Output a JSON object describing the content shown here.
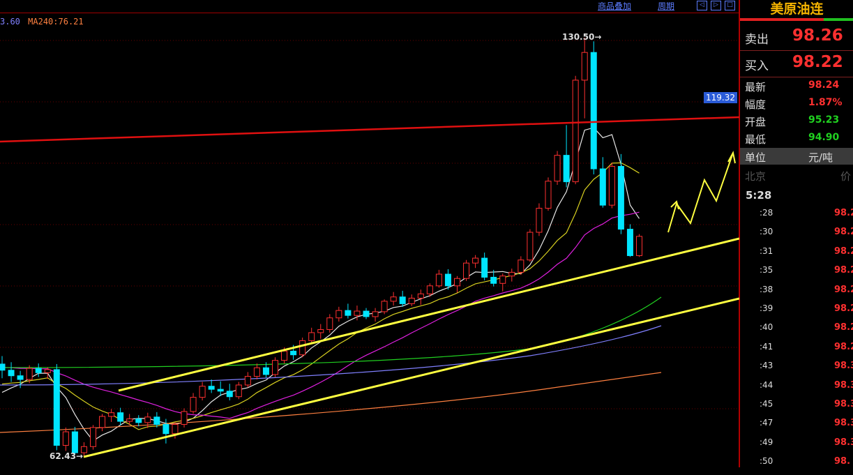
{
  "toolbar": {
    "ma_text": "3.60",
    "ma240_text": "MA240:76.21",
    "overlay_link": "商品叠加",
    "period_link": "周期",
    "nav_left": "◁",
    "nav_right": "▷",
    "nav_box": "□"
  },
  "chart_labels": {
    "high": "130.50",
    "low": "62.43",
    "current_price_tag": "119.32"
  },
  "quote_panel": {
    "title": "美原油连",
    "sell_label": "卖出",
    "sell_value": "98.26",
    "buy_label": "买入",
    "buy_value": "98.22",
    "stats": [
      {
        "label": "最新",
        "value": "98.24",
        "color": "#ff3030"
      },
      {
        "label": "幅度",
        "value": "1.87%",
        "color": "#ff3030"
      },
      {
        "label": "开盘",
        "value": "95.23",
        "color": "#20d020"
      },
      {
        "label": "最低",
        "value": "94.90",
        "color": "#20d020"
      }
    ],
    "unit_label": "单位",
    "unit_value": "元/吨",
    "tick_header_left": "北京",
    "tick_header_right": "价",
    "first_time": "5:28",
    "ticks": [
      {
        "time": ":28",
        "price": "98.2"
      },
      {
        "time": ":30",
        "price": "98.2"
      },
      {
        "time": ":31",
        "price": "98.2"
      },
      {
        "time": ":35",
        "price": "98.2"
      },
      {
        "time": ":38",
        "price": "98.2"
      },
      {
        "time": ":39",
        "price": "98.2"
      },
      {
        "time": ":40",
        "price": "98.2"
      },
      {
        "time": ":41",
        "price": "98.2"
      },
      {
        "time": ":43",
        "price": "98.3"
      },
      {
        "time": ":44",
        "price": "98.3"
      },
      {
        "time": ":45",
        "price": "98.3"
      },
      {
        "time": ":47",
        "price": "98.3"
      },
      {
        "time": ":49",
        "price": "98.3"
      },
      {
        "time": ":50",
        "price": "98."
      }
    ]
  },
  "colors": {
    "up": "#ff3030",
    "down": "#00e5ff",
    "trendline": "#ffff40",
    "resistance": "#e01010"
  },
  "chart_data": {
    "type": "candlestick",
    "high_value": 130.5,
    "low_value": 62.43,
    "price_tag": 119.32,
    "ohlc": [
      [
        77.5,
        78.8,
        75.2,
        76.5
      ],
      [
        76.5,
        77.8,
        74.6,
        75.6
      ],
      [
        75.6,
        76.4,
        73.6,
        75.0
      ],
      [
        75.0,
        77.3,
        74.4,
        76.8
      ],
      [
        76.8,
        77.6,
        75.4,
        76.1
      ],
      [
        76.1,
        77.0,
        75.1,
        76.6
      ],
      [
        76.6,
        77.5,
        63.5,
        64.3
      ],
      [
        64.3,
        67.2,
        63.4,
        66.5
      ],
      [
        66.5,
        67.3,
        62.8,
        63.1
      ],
      [
        63.1,
        64.8,
        62.4,
        64.1
      ],
      [
        64.1,
        67.6,
        63.6,
        67.2
      ],
      [
        67.2,
        69.4,
        66.6,
        69.0
      ],
      [
        69.0,
        70.2,
        68.1,
        69.6
      ],
      [
        69.6,
        70.4,
        67.6,
        68.2
      ],
      [
        68.2,
        69.4,
        67.6,
        68.6
      ],
      [
        68.6,
        69.2,
        67.4,
        68.0
      ],
      [
        68.0,
        69.6,
        67.1,
        68.9
      ],
      [
        68.9,
        69.7,
        67.2,
        67.7
      ],
      [
        67.7,
        68.6,
        64.6,
        66.2
      ],
      [
        66.2,
        68.0,
        65.4,
        67.7
      ],
      [
        67.7,
        70.3,
        67.2,
        69.8
      ],
      [
        69.8,
        72.8,
        69.4,
        72.1
      ],
      [
        72.1,
        74.6,
        71.6,
        73.9
      ],
      [
        73.9,
        75.0,
        72.8,
        73.4
      ],
      [
        73.4,
        74.7,
        72.3,
        73.1
      ],
      [
        73.1,
        74.3,
        71.6,
        72.2
      ],
      [
        72.2,
        74.6,
        71.8,
        74.1
      ],
      [
        74.1,
        76.2,
        73.7,
        75.5
      ],
      [
        75.5,
        77.6,
        75.0,
        76.9
      ],
      [
        76.9,
        77.8,
        75.3,
        75.8
      ],
      [
        75.8,
        78.6,
        75.4,
        78.1
      ],
      [
        78.1,
        80.2,
        77.6,
        79.6
      ],
      [
        79.6,
        80.6,
        78.2,
        79.0
      ],
      [
        79.0,
        81.8,
        78.6,
        81.3
      ],
      [
        81.3,
        83.4,
        80.8,
        82.6
      ],
      [
        82.6,
        84.0,
        81.6,
        83.1
      ],
      [
        83.1,
        85.6,
        82.6,
        85.0
      ],
      [
        85.0,
        86.8,
        84.4,
        86.2
      ],
      [
        86.2,
        87.3,
        84.9,
        85.4
      ],
      [
        85.4,
        87.0,
        84.6,
        86.1
      ],
      [
        86.1,
        86.6,
        84.8,
        85.2
      ],
      [
        85.2,
        86.6,
        84.4,
        86.0
      ],
      [
        86.0,
        88.0,
        85.6,
        87.7
      ],
      [
        87.7,
        89.2,
        87.0,
        88.4
      ],
      [
        88.4,
        89.4,
        86.8,
        87.3
      ],
      [
        87.3,
        88.8,
        86.9,
        88.2
      ],
      [
        88.2,
        89.6,
        87.1,
        88.9
      ],
      [
        88.9,
        90.6,
        88.4,
        90.2
      ],
      [
        90.2,
        92.8,
        89.9,
        92.1
      ],
      [
        92.1,
        92.9,
        89.6,
        90.2
      ],
      [
        90.2,
        91.8,
        89.1,
        91.4
      ],
      [
        91.4,
        94.4,
        91.0,
        93.9
      ],
      [
        93.9,
        95.2,
        93.1,
        94.7
      ],
      [
        94.7,
        95.6,
        91.1,
        91.6
      ],
      [
        91.6,
        92.8,
        90.1,
        90.6
      ],
      [
        90.6,
        92.2,
        89.3,
        91.8
      ],
      [
        91.8,
        93.0,
        90.9,
        92.4
      ],
      [
        92.4,
        95.0,
        92.0,
        94.4
      ],
      [
        94.4,
        99.4,
        94.1,
        98.9
      ],
      [
        98.9,
        103.6,
        98.3,
        102.8
      ],
      [
        102.8,
        107.8,
        102.4,
        107.2
      ],
      [
        107.2,
        112.1,
        106.6,
        111.4
      ],
      [
        111.4,
        116.3,
        106.2,
        107.1
      ],
      [
        107.1,
        124.3,
        106.7,
        123.6
      ],
      [
        123.6,
        130.5,
        117.4,
        128.1
      ],
      [
        128.1,
        129.9,
        108.3,
        109.2
      ],
      [
        109.2,
        111.1,
        102.9,
        103.3
      ],
      [
        103.3,
        110.2,
        102.8,
        109.6
      ],
      [
        109.6,
        111.6,
        98.6,
        99.4
      ],
      [
        99.4,
        100.2,
        94.9,
        95.1
      ],
      [
        95.1,
        98.6,
        94.9,
        98.24
      ]
    ],
    "ma_lines": [
      {
        "name": "ma_white",
        "color": "#e8e8e8"
      },
      {
        "name": "ma_yellow",
        "color": "#d8d020"
      },
      {
        "name": "ma_magenta",
        "color": "#e020e0"
      },
      {
        "name": "ma_green",
        "color": "#20d020"
      },
      {
        "name": "ma_blue",
        "color": "#8080ff"
      },
      {
        "name": "ma_orange",
        "color": "#ff8040"
      }
    ]
  }
}
